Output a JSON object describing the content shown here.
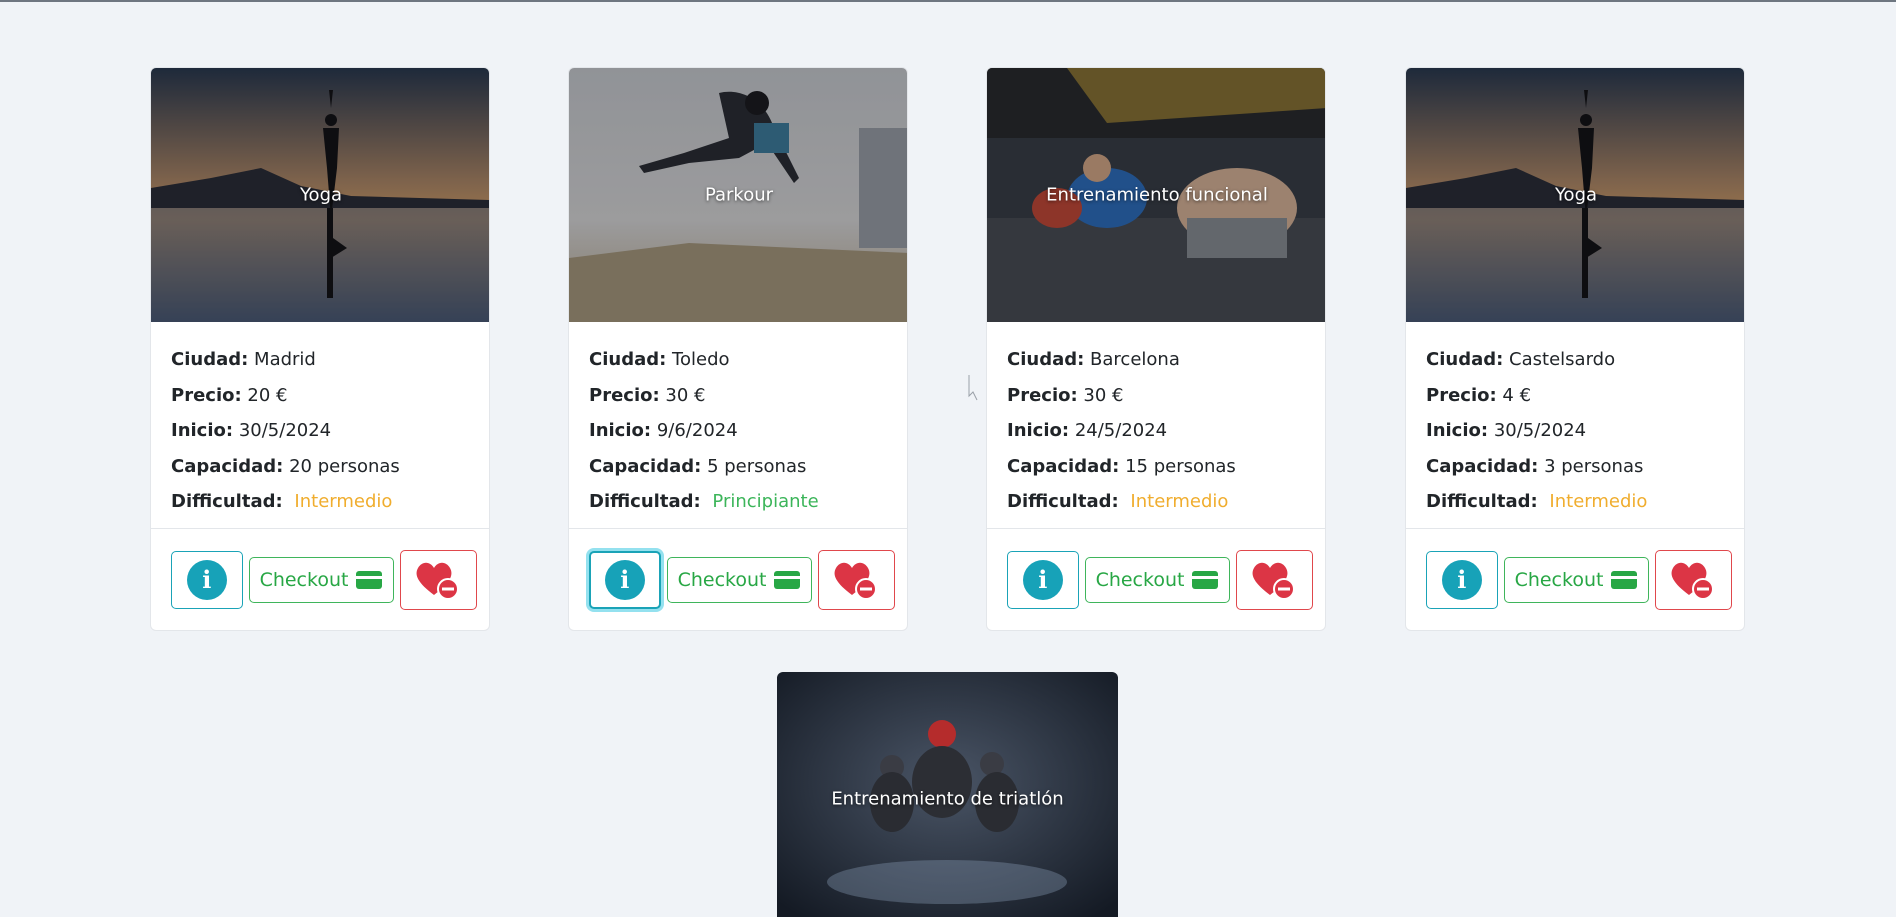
{
  "cards": [
    {
      "title": "Yoga",
      "ciudad_label": "Ciudad:",
      "ciudad": "Madrid",
      "precio_label": "Precio:",
      "precio": "20 €",
      "inicio_label": "Inicio:",
      "inicio": "30/5/2024",
      "capacidad_label": "Capacidad:",
      "capacidad": "20 personas",
      "dificultad_label": "Difficultad:",
      "dificultad": "Intermedio",
      "dificultad_color": "#f0ad2e",
      "checkout_label": "Checkout"
    },
    {
      "title": "Parkour",
      "ciudad_label": "Ciudad:",
      "ciudad": "Toledo",
      "precio_label": "Precio:",
      "precio": "30 €",
      "inicio_label": "Inicio:",
      "inicio": "9/6/2024",
      "capacidad_label": "Capacidad:",
      "capacidad": "5 personas",
      "dificultad_label": "Difficultad:",
      "dificultad": "Principiante",
      "dificultad_color": "#3cb55a",
      "checkout_label": "Checkout"
    },
    {
      "title": "Entrenamiento funcional",
      "ciudad_label": "Ciudad:",
      "ciudad": "Barcelona",
      "precio_label": "Precio:",
      "precio": "30 €",
      "inicio_label": "Inicio:",
      "inicio": "24/5/2024",
      "capacidad_label": "Capacidad:",
      "capacidad": "15 personas",
      "dificultad_label": "Difficultad:",
      "dificultad": "Intermedio",
      "dificultad_color": "#f0ad2e",
      "checkout_label": "Checkout"
    },
    {
      "title": "Yoga",
      "ciudad_label": "Ciudad:",
      "ciudad": "Castelsardo",
      "precio_label": "Precio:",
      "precio": "4 €",
      "inicio_label": "Inicio:",
      "inicio": "30/5/2024",
      "capacidad_label": "Capacidad:",
      "capacidad": "3 personas",
      "dificultad_label": "Difficultad:",
      "dificultad": "Intermedio",
      "dificultad_color": "#f0ad2e",
      "checkout_label": "Checkout"
    }
  ],
  "bottom_card": {
    "title": "Entrenamiento de triatlón"
  },
  "icons": {
    "info": "info-icon",
    "checkout": "credit-card-icon",
    "favorite": "heart-remove-icon"
  },
  "colors": {
    "info": "#17a2b8",
    "checkout": "#28a745",
    "favorite": "#dc3545",
    "background": "#f0f3f7"
  }
}
